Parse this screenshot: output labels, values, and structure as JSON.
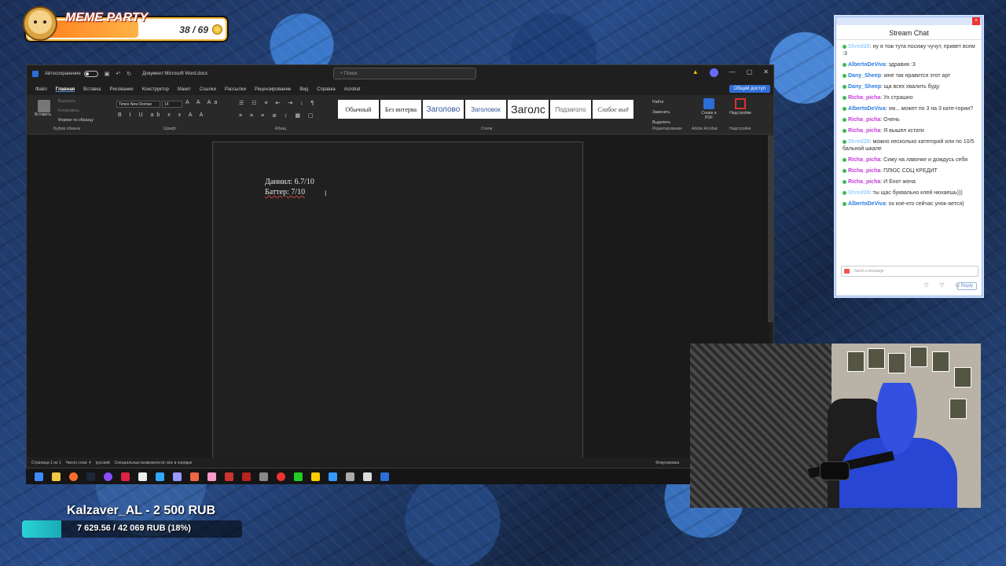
{
  "meme_widget": {
    "title": "MEME PARTY",
    "count": "38 / 69",
    "progress": 0.55
  },
  "word": {
    "titlebar": {
      "autosave": "Автосохранение",
      "doc_name": "Документ Microsoft Word.docx",
      "search_placeholder": "Поиск"
    },
    "tabs": [
      "Файл",
      "Главная",
      "Вставка",
      "Рисование",
      "Конструктор",
      "Макет",
      "Ссылки",
      "Рассылки",
      "Рецензирование",
      "Вид",
      "Справка",
      "Acrobat"
    ],
    "share_label": "Общий доступ",
    "ribbon": {
      "paste": "Вставить",
      "clipboard_items": [
        "Вырезать",
        "Копировать",
        "Формат по образцу"
      ],
      "font_name": "Times New Roman",
      "font_size": "14",
      "styles": [
        "Обычный",
        "Без интерва",
        "Заголово",
        "Заголовок",
        "Заголс",
        "Подзаголо",
        "Слабое выд"
      ],
      "edit_items": [
        "Найти",
        "Заменить",
        "Выделить"
      ],
      "create_pdf": "Create a PDF",
      "addins": "Надстройки",
      "group_labels": {
        "clipboard": "Буфер обмена",
        "font": "Шрифт",
        "paragraph": "Абзац",
        "styles": "Стили",
        "editing": "Редактирование",
        "acrobat": "Adobe Acrobat",
        "addins": "Надстройки"
      }
    },
    "document": {
      "lines": [
        "Даннил: 6.7/10",
        "Баттер: 7/10"
      ]
    },
    "statusbar": {
      "page": "Страница 1 из 1",
      "words": "Число слов: 4",
      "lang": "русский",
      "accessibility": "Специальные возможности: все в порядке",
      "focus": "Фокусировка"
    }
  },
  "chat": {
    "title": "Stream Chat",
    "messages": [
      {
        "user": "Shred26",
        "color": "#9ad0ff",
        "text": "ну я тож тута посижу чучут, привет всем :3"
      },
      {
        "user": "AlbertoDeViva",
        "color": "#2a7de1",
        "text": "здравия :3"
      },
      {
        "user": "Dany_Sheep",
        "color": "#2a7de1",
        "text": "мне так нравится этот арт"
      },
      {
        "user": "Dany_Sheep",
        "color": "#2a7de1",
        "text": "ща всех хвалить буду"
      },
      {
        "user": "Richa_picha",
        "color": "#c43bd6",
        "text": "Ух страшно"
      },
      {
        "user": "AlbertoDeViva",
        "color": "#2a7de1",
        "text": "хм... может по 3 на 3 кате-гории?"
      },
      {
        "user": "Richa_picha",
        "color": "#c43bd6",
        "text": "Очень"
      },
      {
        "user": "Richa_picha",
        "color": "#c43bd6",
        "text": "Я вышел кстати"
      },
      {
        "user": "Shred26",
        "color": "#9ad0ff",
        "text": "можно несколько категорий или по 10/5 бальной шкале"
      },
      {
        "user": "Richa_picha",
        "color": "#c43bd6",
        "text": "Сижу на лавочке и дождусь себя"
      },
      {
        "user": "Richa_picha",
        "color": "#c43bd6",
        "text": "ПЛЮС СОЦ КРЕДИТ"
      },
      {
        "user": "Richa_picha",
        "color": "#c43bd6",
        "text": "И Енот жена"
      },
      {
        "user": "Shred26",
        "color": "#9ad0ff",
        "text": "ты щас буквально клей нюхаешь)))"
      },
      {
        "user": "AlbertoDeViva",
        "color": "#2a7de1",
        "text": "ох кое-кто сейчас унок-ается)"
      }
    ],
    "input_placeholder": "Send a message",
    "reply_label": "Reply"
  },
  "donation": {
    "top_donor": "Kalzaver_AL - 2 500 RUB",
    "goal_text": "7 629.56 / 42 069 RUB (18%)",
    "goal_progress": 0.18
  }
}
